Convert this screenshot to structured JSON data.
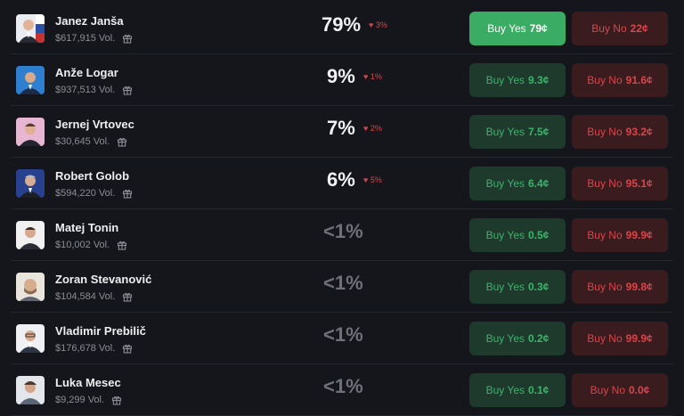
{
  "candidates": [
    {
      "name": "Janez Janša",
      "volume": "$617,915 Vol.",
      "percent": "79%",
      "change": "3%",
      "yes_label": "Buy Yes",
      "yes_price": "79¢",
      "no_label": "Buy No",
      "no_price": "22¢"
    },
    {
      "name": "Anže Logar",
      "volume": "$937,513 Vol.",
      "percent": "9%",
      "change": "1%",
      "yes_label": "Buy Yes",
      "yes_price": "9.3¢",
      "no_label": "Buy No",
      "no_price": "91.6¢"
    },
    {
      "name": "Jernej Vrtovec",
      "volume": "$30,645 Vol.",
      "percent": "7%",
      "change": "2%",
      "yes_label": "Buy Yes",
      "yes_price": "7.5¢",
      "no_label": "Buy No",
      "no_price": "93.2¢"
    },
    {
      "name": "Robert Golob",
      "volume": "$594,220 Vol.",
      "percent": "6%",
      "change": "5%",
      "yes_label": "Buy Yes",
      "yes_price": "6.4¢",
      "no_label": "Buy No",
      "no_price": "95.1¢"
    },
    {
      "name": "Matej Tonin",
      "volume": "$10,002 Vol.",
      "percent": "<1%",
      "yes_label": "Buy Yes",
      "yes_price": "0.5¢",
      "no_label": "Buy No",
      "no_price": "99.9¢"
    },
    {
      "name": "Zoran Stevanović",
      "volume": "$104,584 Vol.",
      "percent": "<1%",
      "yes_label": "Buy Yes",
      "yes_price": "0.3¢",
      "no_label": "Buy No",
      "no_price": "99.8¢"
    },
    {
      "name": "Vladimir Prebilič",
      "volume": "$176,678 Vol.",
      "percent": "<1%",
      "yes_label": "Buy Yes",
      "yes_price": "0.2¢",
      "no_label": "Buy No",
      "no_price": "99.9¢"
    },
    {
      "name": "Luka Mesec",
      "volume": "$9,299 Vol.",
      "percent": "<1%",
      "yes_label": "Buy Yes",
      "yes_price": "0.1¢",
      "no_label": "Buy No",
      "no_price": "0.0¢"
    }
  ],
  "icons": {
    "gift": "gift-icon",
    "change_down": "heart-icon"
  },
  "colors": {
    "yes_green": "#3bac63",
    "no_red": "#d8454b",
    "change_red": "#d6454b"
  }
}
